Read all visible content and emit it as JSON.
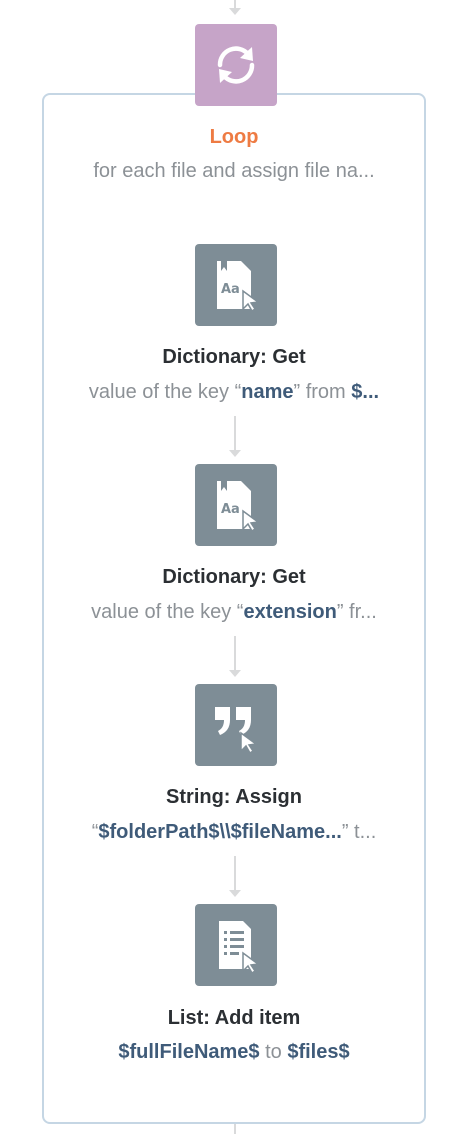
{
  "loop": {
    "title": "Loop",
    "description": "for each file and assign file na..."
  },
  "steps": [
    {
      "title": "Dictionary: Get",
      "pre": "value of the key “",
      "key": "name",
      "mid": "” from ",
      "var": "$...",
      "icon": "dictionary-icon",
      "icon_text": "Aa"
    },
    {
      "title": "Dictionary: Get",
      "pre": "value of the key “",
      "key": "extension",
      "mid": "” fr...",
      "icon": "dictionary-icon",
      "icon_text": "Aa"
    },
    {
      "title": "String: Assign",
      "pre": "“",
      "value": "$folderPath$\\\\$fileName...",
      "mid": "” t...",
      "icon": "quote-icon"
    },
    {
      "title": "List: Add item",
      "var1": "$fullFileName$",
      "mid": " to ",
      "var2": "$files$",
      "icon": "list-icon"
    }
  ],
  "colors": {
    "loop_icon_bg": "#c6a4c8",
    "action_icon_bg": "#7e8d96",
    "loop_title": "#ee7b43",
    "variable_text": "#3f5b79",
    "frame_border": "#c5d6e4"
  }
}
